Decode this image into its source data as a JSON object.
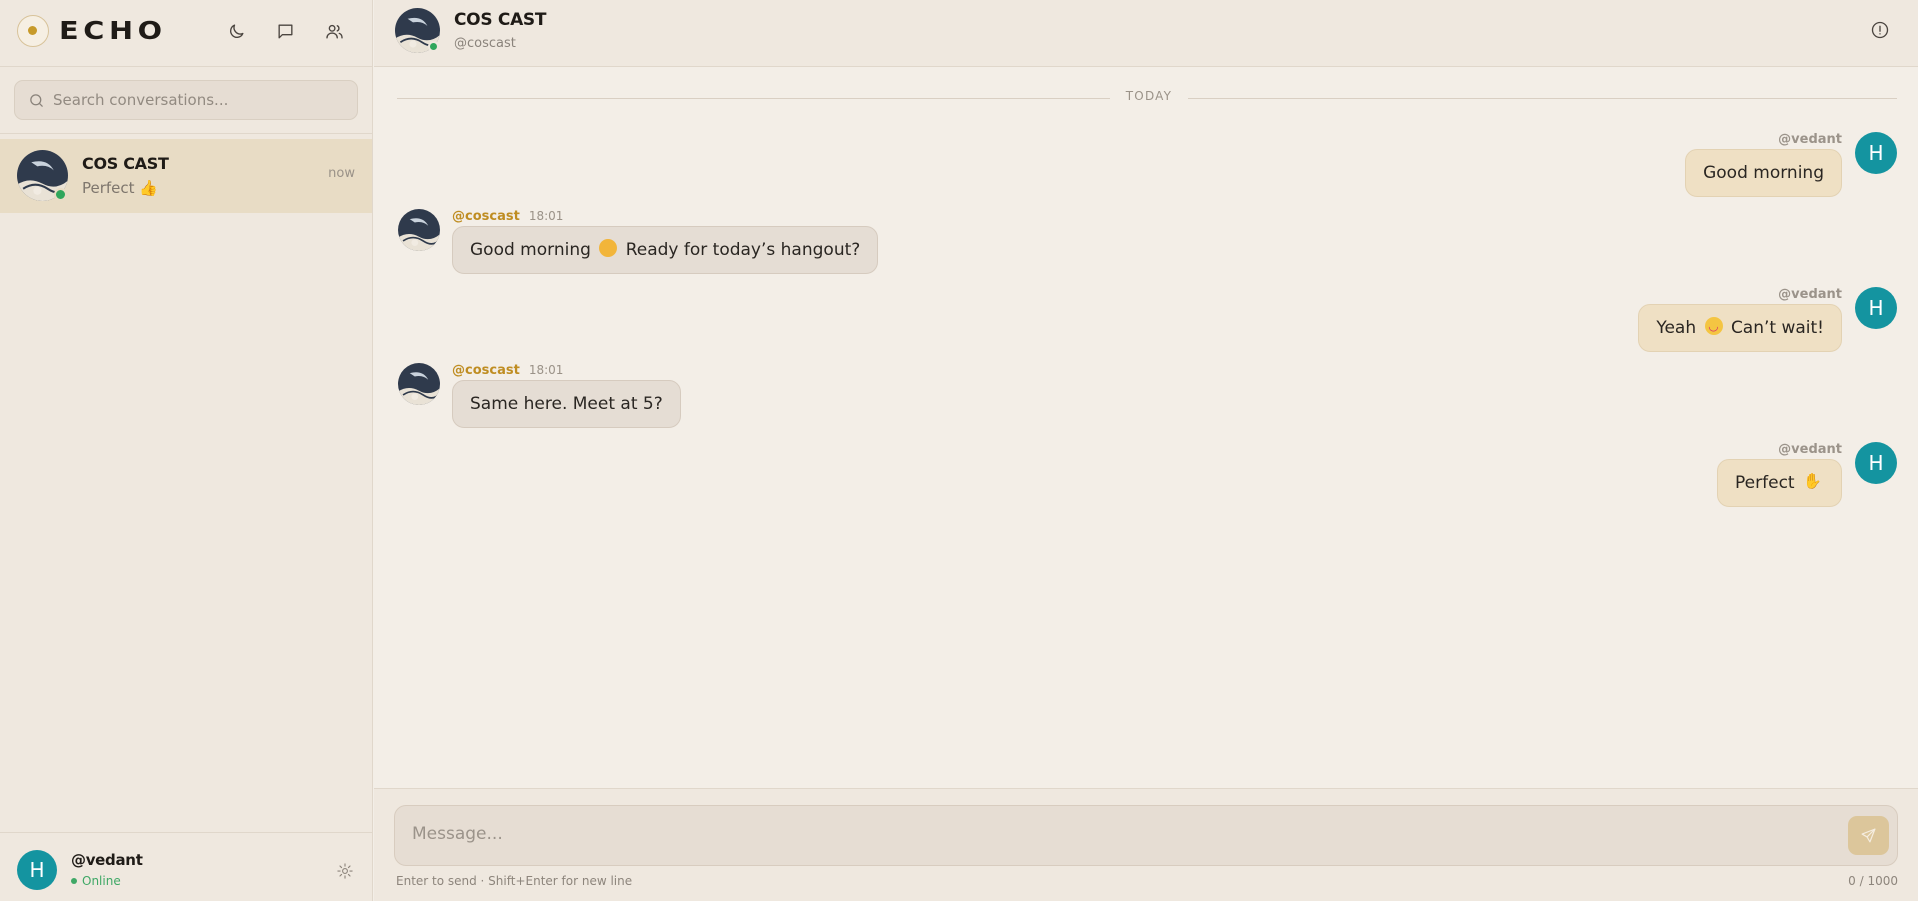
{
  "app": {
    "logo_text": "ECHO"
  },
  "sidebar": {
    "search_placeholder": "Search conversations...",
    "conversations": [
      {
        "name": "COS CAST",
        "preview": "Perfect 👍",
        "time": "now",
        "online": true
      }
    ],
    "me": {
      "handle": "@vedant",
      "status": "Online",
      "avatar_letter": "H"
    }
  },
  "chat": {
    "name": "COS CAST",
    "handle": "@coscast",
    "day_separator": "TODAY",
    "messages": [
      {
        "direction": "out",
        "author": "@vedant",
        "avatar_letter": "H",
        "text": "Good morning"
      },
      {
        "direction": "in",
        "author": "@coscast",
        "time": "18:01",
        "text_before": "Good morning",
        "emoji": "🌞",
        "text_after": "Ready for today’s hangout?"
      },
      {
        "direction": "out",
        "author": "@vedant",
        "avatar_letter": "H",
        "text_before": "Yeah",
        "emoji": "😄",
        "text_after": "Can’t wait!"
      },
      {
        "direction": "in",
        "author": "@coscast",
        "time": "18:01",
        "text": "Same here. Meet at 5?"
      },
      {
        "direction": "out",
        "author": "@vedant",
        "avatar_letter": "H",
        "text_before": "Perfect",
        "emoji": "👍"
      }
    ]
  },
  "composer": {
    "placeholder": "Message...",
    "hint": "Enter to send · Shift+Enter for new line",
    "counter": "0 / 1000"
  },
  "colors": {
    "accent": "#c79a2a",
    "avatar_teal": "#1494a0",
    "online": "#2fa65c"
  },
  "icons": [
    "moon-icon",
    "chat-icon",
    "users-icon",
    "search-icon",
    "settings-icon",
    "info-icon",
    "send-icon"
  ]
}
